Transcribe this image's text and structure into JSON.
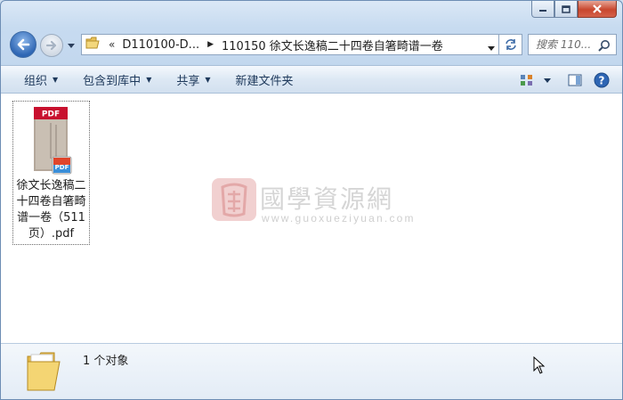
{
  "window": {
    "controls": [
      "minimize",
      "maximize",
      "close"
    ]
  },
  "nav": {
    "back_label": "Back",
    "forward_label": "Forward",
    "address": {
      "prefix": "«",
      "crumbs": [
        "D110100-D...",
        "110150 徐文长逸稿二十四卷自箸畸谱一卷"
      ]
    },
    "search": {
      "placeholder": "搜索 110..."
    }
  },
  "toolbar": {
    "organize": "组织",
    "include_library": "包含到库中",
    "share": "共享",
    "new_folder": "新建文件夹"
  },
  "files": [
    {
      "name": "徐文长逸稿二十四卷自箸畸谱一卷（511页）.pdf",
      "thumb_badge": "PDF",
      "icon": "pdf-file-icon"
    }
  ],
  "watermark": {
    "title": "國學資源網",
    "url": "www.guoxueziyuan.com"
  },
  "details": {
    "count": "1 个对象"
  },
  "colors": {
    "pdf_red": "#c8102e",
    "accent_blue": "#2e66b4"
  }
}
